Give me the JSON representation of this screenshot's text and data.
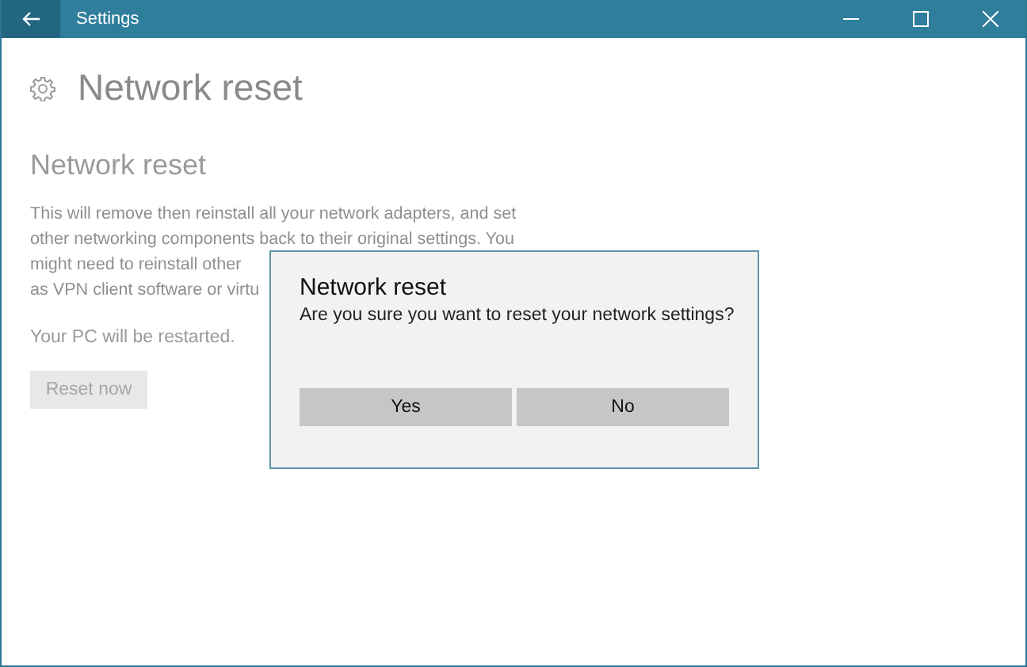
{
  "window": {
    "title": "Settings"
  },
  "page": {
    "title": "Network reset",
    "section_title": "Network reset",
    "description_lines": [
      "This will remove then reinstall all your network adapters, and set",
      "other networking components back to their original settings. You",
      "might need to reinstall other",
      "as VPN client software or virtu"
    ],
    "note": "Your PC will be restarted.",
    "reset_button": {
      "label": "Reset now",
      "disabled": true
    }
  },
  "dialog": {
    "title": "Network reset",
    "message": "Are you sure you want to reset your network settings?",
    "buttons": [
      "Yes",
      "No"
    ]
  }
}
